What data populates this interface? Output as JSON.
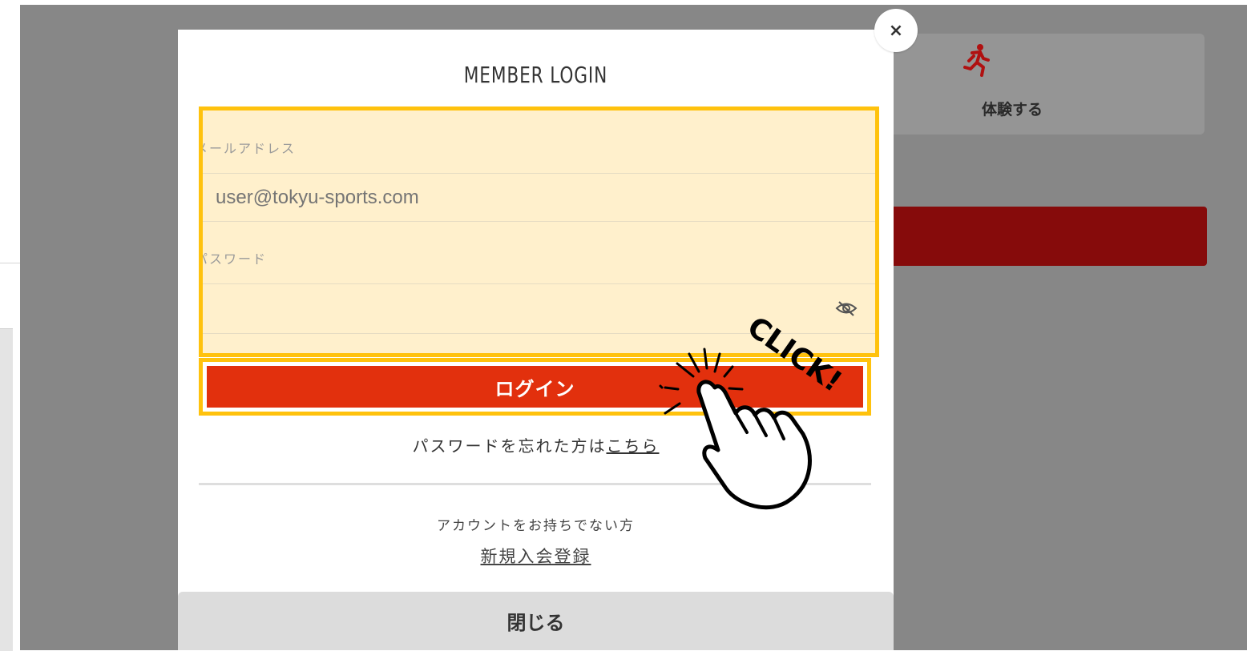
{
  "background": {
    "experience_card": {
      "label": "体験する",
      "icon": "running-person-icon"
    },
    "accent_color": "#860b0b"
  },
  "modal": {
    "close_icon": "×",
    "title": "MEMBER LOGIN",
    "email": {
      "label": "メールアドレス",
      "placeholder": "user@tokyu-sports.com",
      "value": ""
    },
    "password": {
      "label": "パスワード",
      "value": "",
      "toggle_icon": "eye-slash-icon"
    },
    "login_button": "ログイン",
    "forgot": {
      "text": "パスワードを忘れた方は",
      "link": "こちら"
    },
    "no_account_text": "アカウントをお持ちでない方",
    "register_link": "新規入会登録",
    "close_button": "閉じる"
  },
  "annotation": {
    "click_text": "CLICK!",
    "highlight_color": "#ffc20d"
  }
}
